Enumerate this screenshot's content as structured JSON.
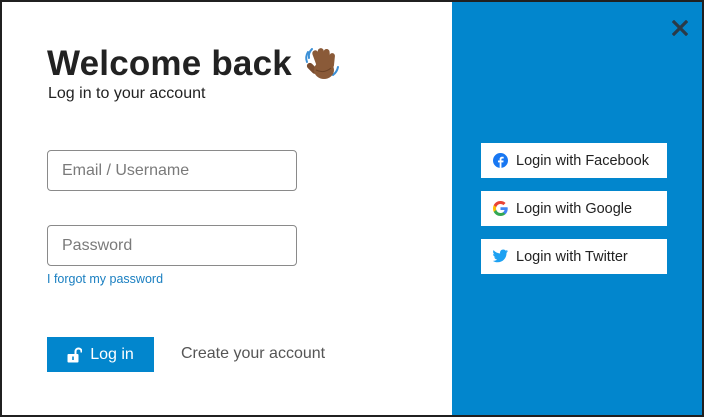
{
  "header": {
    "title": "Welcome back",
    "subtitle": "Log in to your account",
    "emoji": "waving-hand"
  },
  "form": {
    "email_placeholder": "Email / Username",
    "email_value": "",
    "password_placeholder": "Password",
    "password_value": "",
    "forgot_label": "I forgot my password",
    "login_label": "Log in",
    "create_account_label": "Create your account"
  },
  "social": {
    "facebook_label": "Login with Facebook",
    "google_label": "Login with Google",
    "twitter_label": "Login with Twitter"
  },
  "icons": {
    "close": "close-icon",
    "lock": "unlock-icon",
    "facebook": "facebook-icon",
    "google": "google-icon",
    "twitter": "twitter-icon"
  },
  "colors": {
    "accent": "#0286cd",
    "link": "#1a7fc1",
    "facebook": "#1877f2",
    "twitter": "#1da1f2"
  }
}
